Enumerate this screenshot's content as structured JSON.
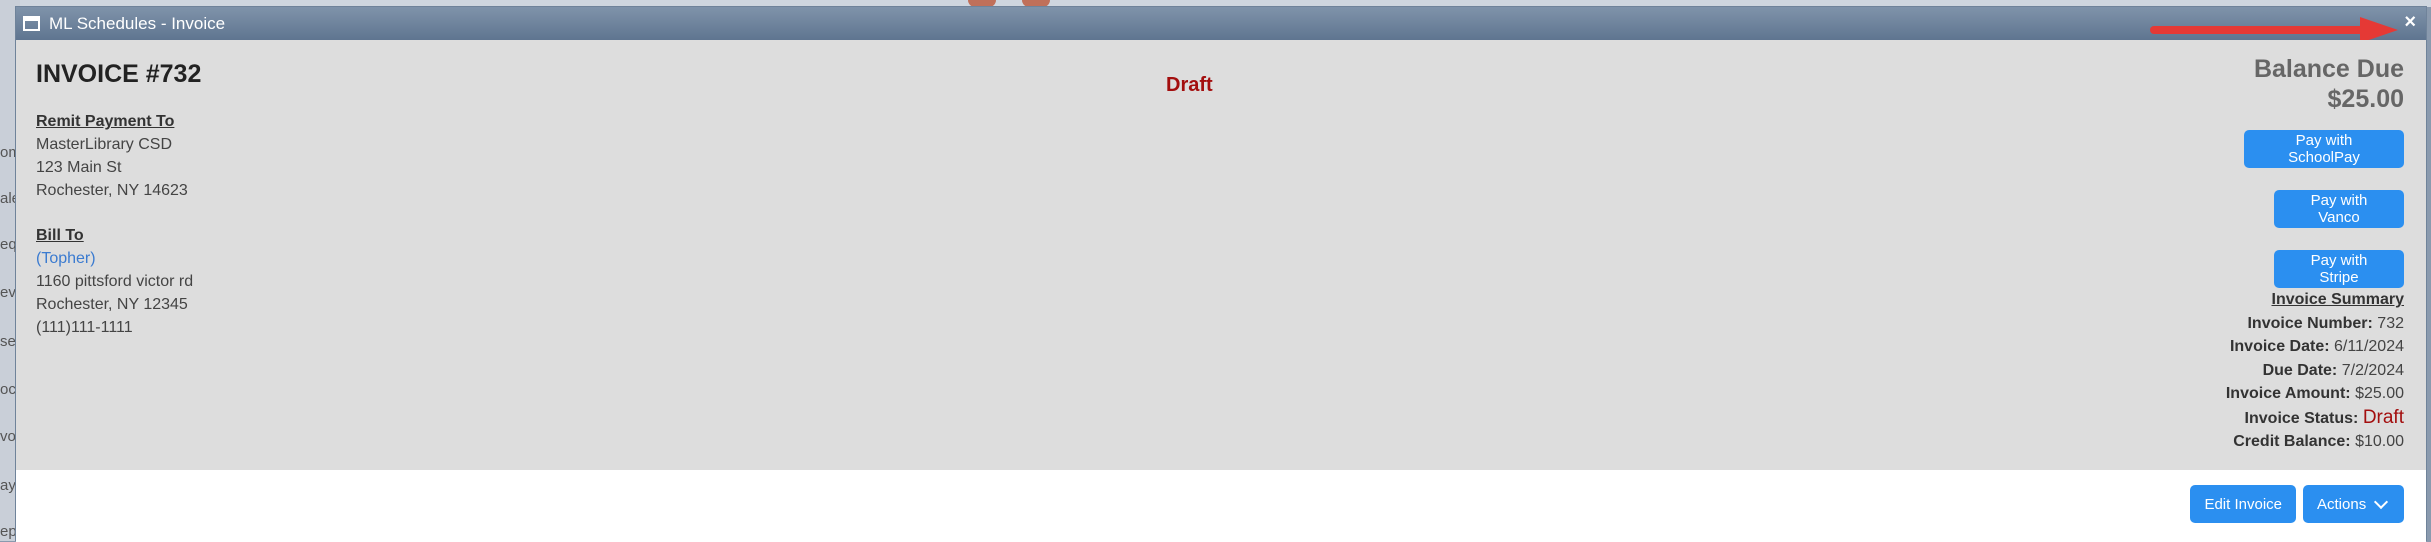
{
  "window": {
    "title": "ML Schedules - Invoice",
    "close_label": "×"
  },
  "background": {
    "fragments": [
      "om",
      "ale",
      "eq",
      "ev",
      "se",
      "oc",
      "vo",
      "ay",
      "ep"
    ]
  },
  "invoice": {
    "title": "INVOICE #732",
    "draft_label": "Draft"
  },
  "remit": {
    "heading": "Remit Payment To",
    "name": "MasterLibrary CSD",
    "street": "123 Main St",
    "city": "Rochester, NY 14623"
  },
  "bill": {
    "heading": "Bill To",
    "name": "(Topher)",
    "street": "1160 pittsford victor rd",
    "city": "Rochester, NY 12345",
    "phone": "(111)111-1111"
  },
  "balance": {
    "label": "Balance Due",
    "amount": "$25.00"
  },
  "payments": {
    "schoolpay": "Pay with SchoolPay",
    "vanco": "Pay with Vanco",
    "stripe": "Pay with Stripe"
  },
  "summary": {
    "heading": "Invoice Summary",
    "number_label": "Invoice Number:",
    "number": "732",
    "date_label": "Invoice Date:",
    "date": "6/11/2024",
    "due_label": "Due Date:",
    "due": "7/2/2024",
    "amount_label": "Invoice Amount:",
    "amount": "$25.00",
    "status_label": "Invoice Status:",
    "status": "Draft",
    "credit_label": "Credit Balance:",
    "credit": "$10.00"
  },
  "footer": {
    "edit_label": "Edit Invoice",
    "actions_label": "Actions"
  },
  "colors": {
    "accent": "#2b8ff0",
    "draft": "#a30e0e",
    "link": "#3b7bd0",
    "arrow": "#e53935"
  },
  "icons": [
    "window-icon",
    "close-icon",
    "red-arrow-annotation",
    "chevron-down-icon"
  ]
}
